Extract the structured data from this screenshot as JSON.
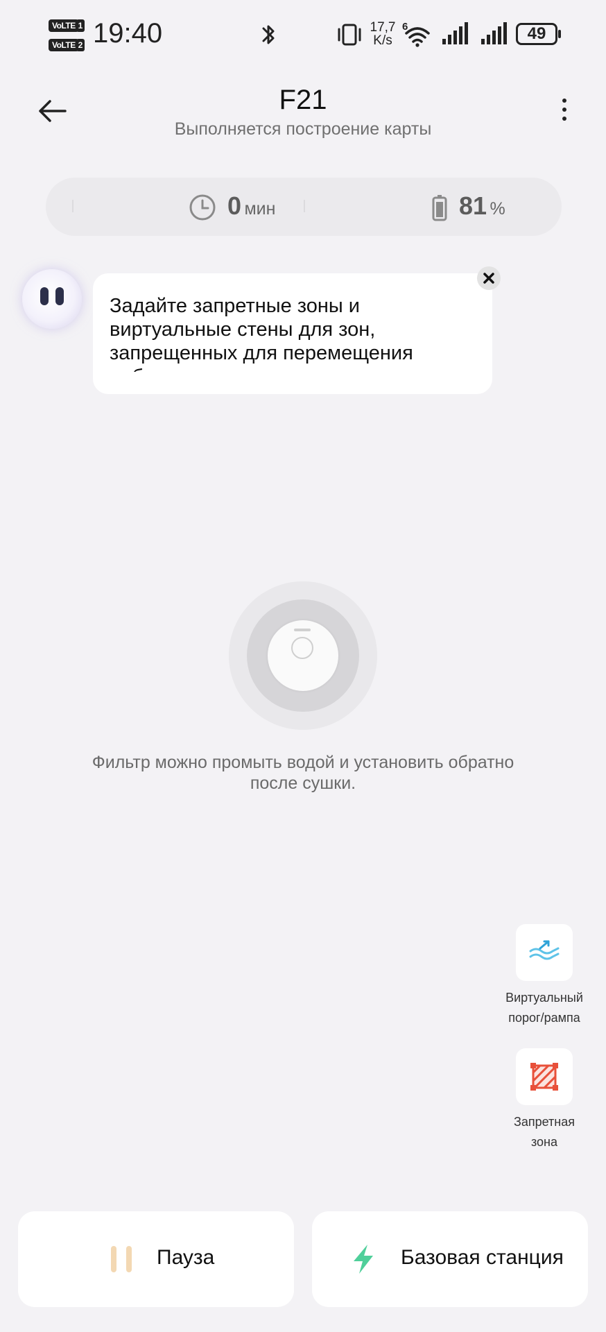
{
  "status_bar": {
    "sim1_tag": "VoLTE",
    "sim1_num": "1",
    "sim2_tag": "VoLTE",
    "sim2_num": "2",
    "time": "19:40",
    "net_speed_value": "17,7",
    "net_speed_unit": "K/s",
    "wifi_badge": "6",
    "battery_level": "49"
  },
  "header": {
    "title": "F21",
    "subtitle": "Выполняется построение карты"
  },
  "stats": {
    "time_value": "0",
    "time_unit": "мин",
    "battery_value": "81",
    "battery_unit": "%"
  },
  "hint": {
    "text": "Задайте запретные зоны и виртуальные стены для зон, запрещенных для перемещения робота"
  },
  "robot": {
    "tip": "Фильтр можно промыть водой и установить обратно после сушки."
  },
  "tools": {
    "threshold_line1": "Виртуальный",
    "threshold_line2": "порог/рампа",
    "zone_line1": "Запретная",
    "zone_line2": "зона"
  },
  "actions": {
    "pause_label": "Пауза",
    "base_label": "Базовая станция"
  },
  "colors": {
    "background": "#f3f2f5",
    "pause_icon": "#f3d8b3",
    "base_icon": "#4fcf9a",
    "threshold_icon": "#5fc3e8",
    "zone_icon": "#e8503a"
  },
  "icons": {
    "back": "arrow-left-icon",
    "more": "more-vertical-icon",
    "time": "clock-icon",
    "battery": "battery-icon",
    "close": "close-icon",
    "threshold": "ramp-waves-icon",
    "zone": "no-go-zone-icon",
    "pause": "pause-icon",
    "base": "lightning-icon"
  }
}
